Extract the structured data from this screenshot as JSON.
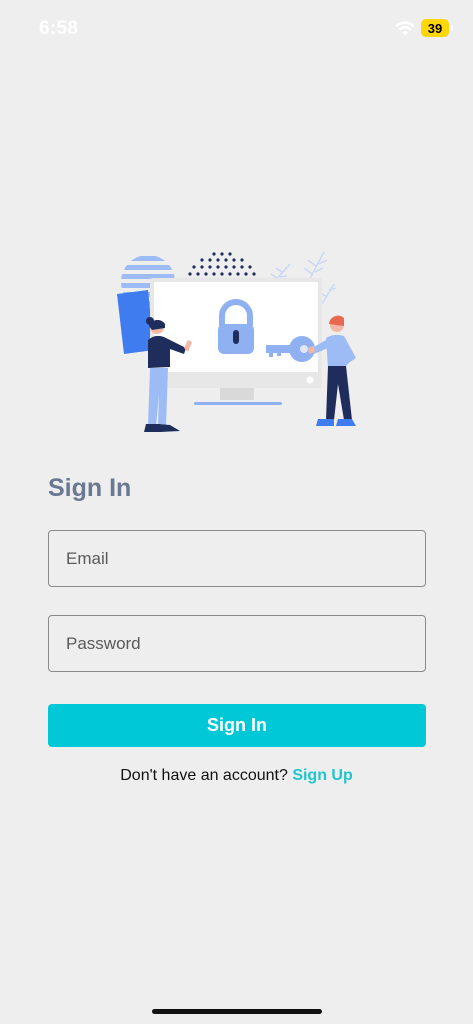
{
  "status_bar": {
    "time": "6:58",
    "battery": "39"
  },
  "login": {
    "title": "Sign In",
    "email_placeholder": "Email",
    "password_placeholder": "Password",
    "submit_label": "Sign In",
    "no_account_text": "Don't have an account? ",
    "signup_label": "Sign Up"
  },
  "colors": {
    "background": "#eeeeee",
    "title": "#6a7891",
    "accent": "#00c8d7",
    "link": "#1ec6cf"
  },
  "icons": [
    "wifi-icon",
    "battery-icon",
    "padlock-icon",
    "key-icon"
  ]
}
